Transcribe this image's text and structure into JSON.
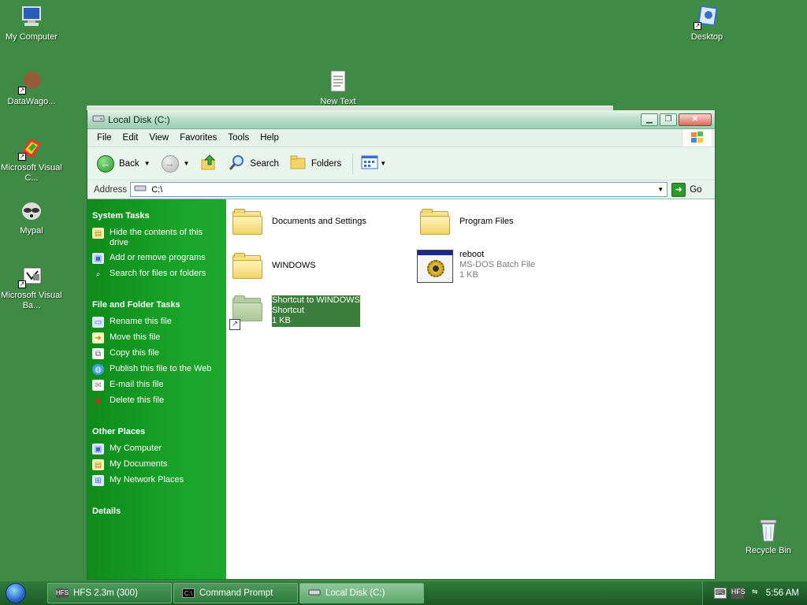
{
  "desktop": {
    "icons": [
      {
        "label": "My Computer"
      },
      {
        "label": "DataWago..."
      },
      {
        "label": "Microsoft Visual C..."
      },
      {
        "label": "Mypal"
      },
      {
        "label": "Microsoft Visual Ba..."
      },
      {
        "label": "New Text"
      },
      {
        "label": "Desktop"
      },
      {
        "label": "Recycle Bin"
      }
    ]
  },
  "window": {
    "title": "Local Disk (C:)",
    "menu": [
      "File",
      "Edit",
      "View",
      "Favorites",
      "Tools",
      "Help"
    ],
    "toolbar": {
      "back": "Back",
      "search": "Search",
      "folders": "Folders"
    },
    "address": {
      "label": "Address",
      "value": "C:\\",
      "go": "Go"
    },
    "sidebar": {
      "system_tasks": {
        "title": "System Tasks",
        "items": [
          "Hide the contents of this drive",
          "Add or remove programs",
          "Search for files or folders"
        ]
      },
      "file_folder_tasks": {
        "title": "File and Folder Tasks",
        "items": [
          "Rename this file",
          "Move this file",
          "Copy this file",
          "Publish this file to the Web",
          "E-mail this file",
          "Delete this file"
        ]
      },
      "other_places": {
        "title": "Other Places",
        "items": [
          "My Computer",
          "My Documents",
          "My Network Places"
        ]
      },
      "details": {
        "title": "Details"
      }
    },
    "files": [
      {
        "name": "Documents and Settings"
      },
      {
        "name": "Program Files"
      },
      {
        "name": "WINDOWS"
      },
      {
        "name": "reboot",
        "type": "MS-DOS Batch File",
        "size": "1 KB"
      },
      {
        "name": "Shortcut to WINDOWS",
        "type": "Shortcut",
        "size": "1 KB"
      }
    ]
  },
  "taskbar": {
    "buttons": [
      "HFS 2.3m (300)",
      "Command Prompt",
      "Local Disk (C:)"
    ],
    "clock": "5:56 AM"
  },
  "colors": {
    "desktop": "#3f8a44",
    "sidebar": "#19a629",
    "selection": "#3b7d3a"
  }
}
